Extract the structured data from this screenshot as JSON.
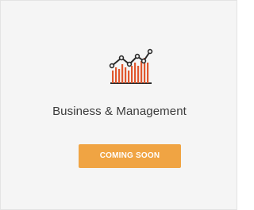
{
  "card": {
    "icon": "bar-line-chart-icon",
    "title": "Business & Management",
    "button_label": "COMING SOON"
  },
  "colors": {
    "accent": "#f0a443",
    "icon_bars": "#e0572e",
    "icon_line": "#2b2b2b",
    "card_background": "#f5f5f5"
  }
}
